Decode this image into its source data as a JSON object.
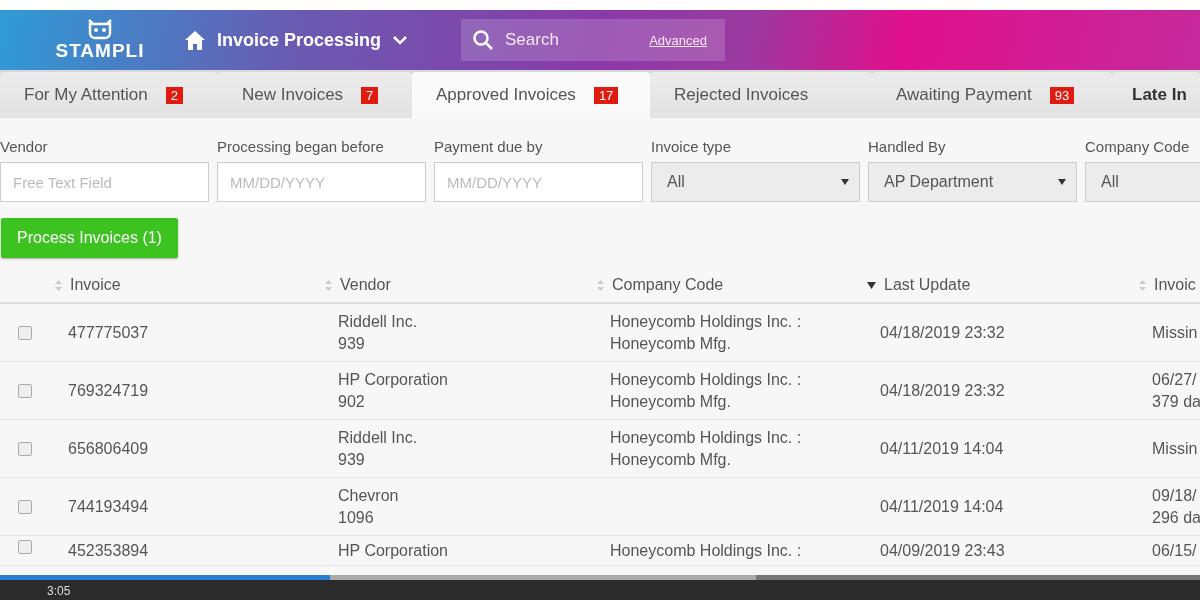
{
  "header": {
    "logo": "STAMPLI",
    "app_menu": "Invoice Processing",
    "search": {
      "placeholder": "Search",
      "advanced_link": "Advanced"
    }
  },
  "tabs": [
    {
      "label": "For My Attention",
      "count": "2",
      "selected": false,
      "emphasis": false
    },
    {
      "label": "New Invoices",
      "count": "7",
      "selected": false,
      "emphasis": false
    },
    {
      "label": "Approved Invoices",
      "count": "17",
      "selected": true,
      "emphasis": false
    },
    {
      "label": "Rejected Invoices",
      "selected": false,
      "emphasis": false
    },
    {
      "label": "Awaiting Payment",
      "count": "93",
      "selected": false,
      "emphasis": false
    },
    {
      "label": "Late In",
      "selected": false,
      "emphasis": true
    }
  ],
  "filters": [
    {
      "label": "Vendor",
      "kind": "text",
      "placeholder": "Free Text Field"
    },
    {
      "label": "Processing began before",
      "kind": "text",
      "placeholder": "MM/DD/YYYY"
    },
    {
      "label": "Payment due by",
      "kind": "text",
      "placeholder": "MM/DD/YYYY"
    },
    {
      "label": "Invoice type",
      "kind": "select",
      "value": "All"
    },
    {
      "label": "Handled By",
      "kind": "select",
      "value": "AP Department"
    },
    {
      "label": "Company Code",
      "kind": "select",
      "value": "All"
    }
  ],
  "process_button": "Process Invoices (1)",
  "table": {
    "columns": [
      {
        "label": "Invoice",
        "sorted": false
      },
      {
        "label": "Vendor",
        "sorted": false
      },
      {
        "label": "Company Code",
        "sorted": false
      },
      {
        "label": "Last Update",
        "sorted": true
      },
      {
        "label": "Invoic",
        "sorted": false
      }
    ],
    "rows": [
      {
        "checked": false,
        "cells": [
          [
            "477775037"
          ],
          [
            "Riddell Inc.",
            "939"
          ],
          [
            "Honeycomb Holdings Inc. :",
            "Honeycomb Mfg."
          ],
          [
            "04/18/2019 23:32"
          ],
          [
            "Missin"
          ]
        ]
      },
      {
        "checked": false,
        "cells": [
          [
            "769324719"
          ],
          [
            "HP Corporation",
            "902"
          ],
          [
            "Honeycomb Holdings Inc. :",
            "Honeycomb Mfg."
          ],
          [
            "04/18/2019 23:32"
          ],
          [
            "06/27/",
            "379 da"
          ]
        ]
      },
      {
        "checked": false,
        "cells": [
          [
            "656806409"
          ],
          [
            "Riddell Inc.",
            "939"
          ],
          [
            "Honeycomb Holdings Inc. :",
            "Honeycomb Mfg."
          ],
          [
            "04/11/2019 14:04"
          ],
          [
            "Missin"
          ]
        ]
      },
      {
        "checked": false,
        "cells": [
          [
            "744193494"
          ],
          [
            "Chevron",
            "1096"
          ],
          [],
          [
            "04/11/2019 14:04"
          ],
          [
            "09/18/",
            "296 da"
          ]
        ]
      },
      {
        "checked": false,
        "cells": [
          [
            "452353894"
          ],
          [
            "HP Corporation"
          ],
          [
            "Honeycomb Holdings Inc. :"
          ],
          [
            "04/09/2019 23:43"
          ],
          [
            "06/15/"
          ]
        ]
      }
    ]
  },
  "player": {
    "time": "3:05",
    "level": 0.275,
    "buffer": {
      "level": 0.63
    }
  }
}
